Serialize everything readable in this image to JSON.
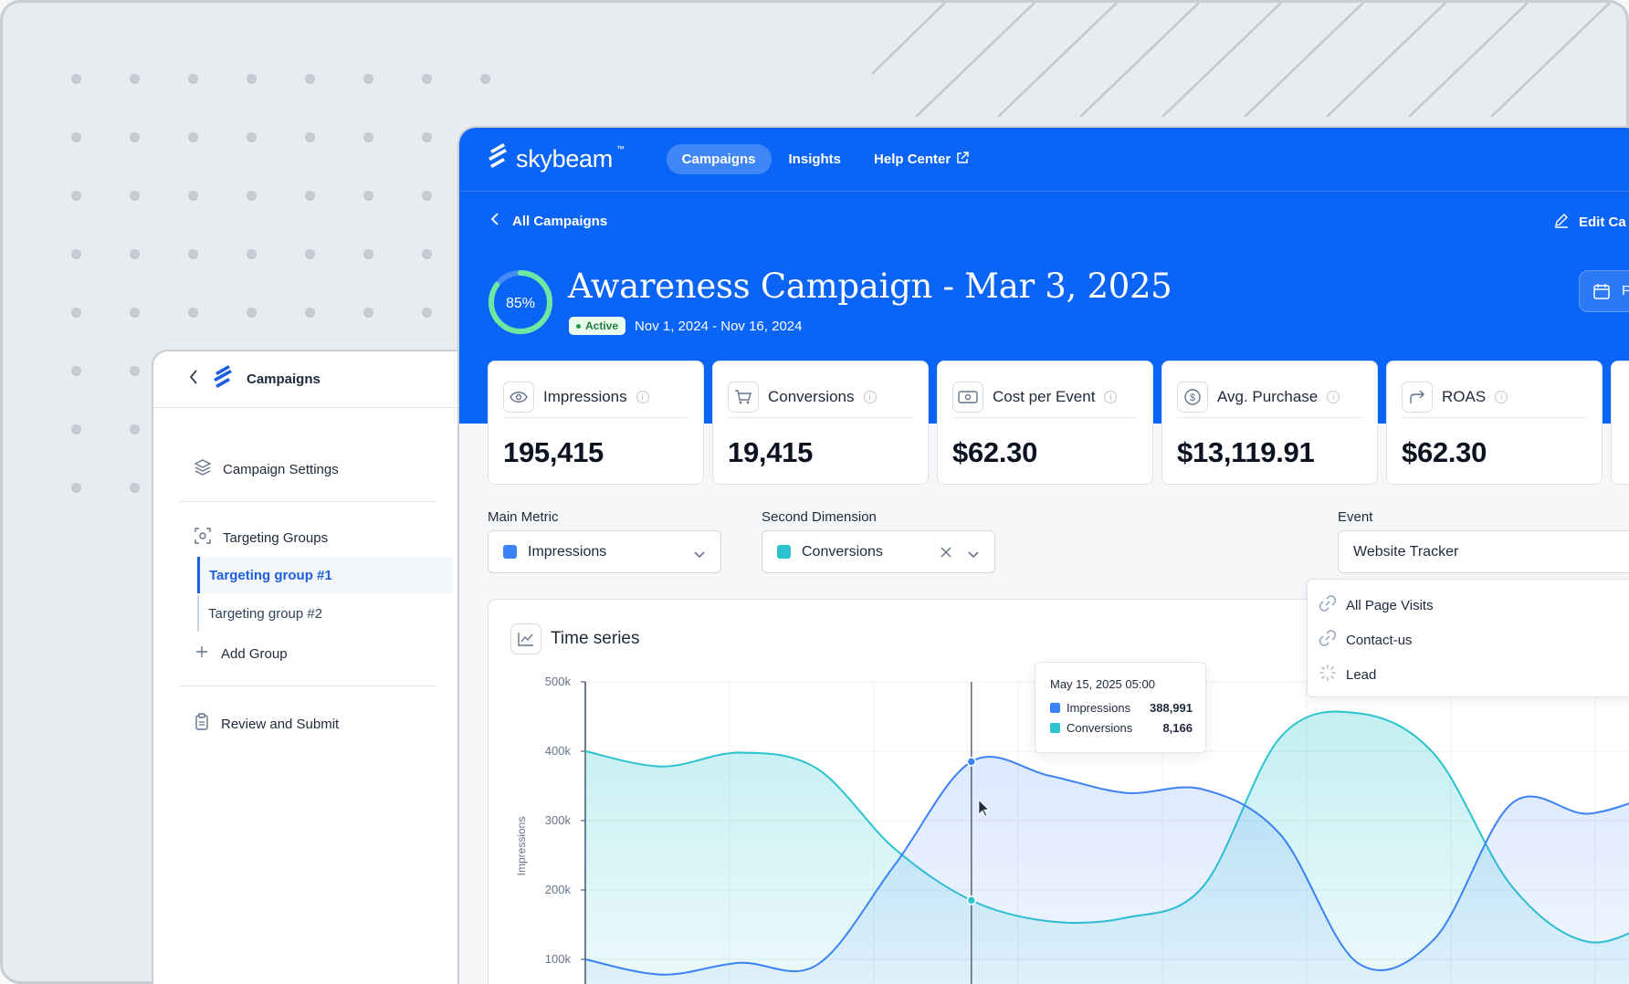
{
  "colors": {
    "brand": "#0a64f5",
    "impressions": "#3b82f6",
    "conversions": "#2bc4cf",
    "active": "#1f9a4c"
  },
  "sidebar": {
    "title": "Campaigns",
    "settings": "Campaign Settings",
    "groups_label": "Targeting Groups",
    "groups": [
      "Targeting group #1",
      "Targeting group #2"
    ],
    "add_group": "Add Group",
    "review": "Review and Submit"
  },
  "nav": {
    "brand": "skybeam",
    "brand_tm": "™",
    "tabs": [
      "Campaigns",
      "Insights",
      "Help Center"
    ]
  },
  "header": {
    "back": "All Campaigns",
    "edit": "Edit Ca",
    "progress_label": "85%",
    "progress": 0.85,
    "title": "Awareness Campaign - Mar 3, 2025",
    "status": "Active",
    "dates": "Nov 1, 2024 - Nov 16, 2024",
    "date_btn": "F"
  },
  "metrics": [
    {
      "label": "Impressions",
      "value": "195,415",
      "icon": "eye-icon"
    },
    {
      "label": "Conversions",
      "value": "19,415",
      "icon": "cart-icon"
    },
    {
      "label": "Cost per Event",
      "value": "$62.30",
      "icon": "cash-icon"
    },
    {
      "label": "Avg. Purchase",
      "value": "$13,119.91",
      "icon": "dollar-icon"
    },
    {
      "label": "ROAS",
      "value": "$62.30",
      "icon": "return-icon"
    }
  ],
  "filters": {
    "main_metric_label": "Main Metric",
    "main_metric": "Impressions",
    "second_dim_label": "Second Dimension",
    "second_dim": "Conversions",
    "event_label": "Event",
    "event": "Website Tracker",
    "event_options": [
      "All Page Visits",
      "Contact-us",
      "Lead"
    ]
  },
  "chart_data": {
    "type": "area",
    "title": "Time series",
    "ylabel": "Impressions",
    "ylim": [
      0,
      500000
    ],
    "yticks": [
      "100k",
      "200k",
      "300k",
      "400k",
      "500k"
    ],
    "tooltip": {
      "date": "May 15, 2025 05:00",
      "rows": [
        {
          "name": "Impressions",
          "value": "388,991"
        },
        {
          "name": "Conversions",
          "value": "8,166"
        }
      ]
    },
    "series": [
      {
        "name": "Impressions",
        "values": [
          100000,
          78000,
          95000,
          92000,
          235000,
          385000,
          365000,
          340000,
          345000,
          280000,
          95000,
          130000,
          325000,
          310000,
          345000
        ]
      },
      {
        "name": "Conversions",
        "values": [
          400000,
          378000,
          398000,
          375000,
          260000,
          185000,
          155000,
          160000,
          205000,
          420000,
          455000,
          395000,
          205000,
          125000,
          165000
        ]
      }
    ]
  }
}
